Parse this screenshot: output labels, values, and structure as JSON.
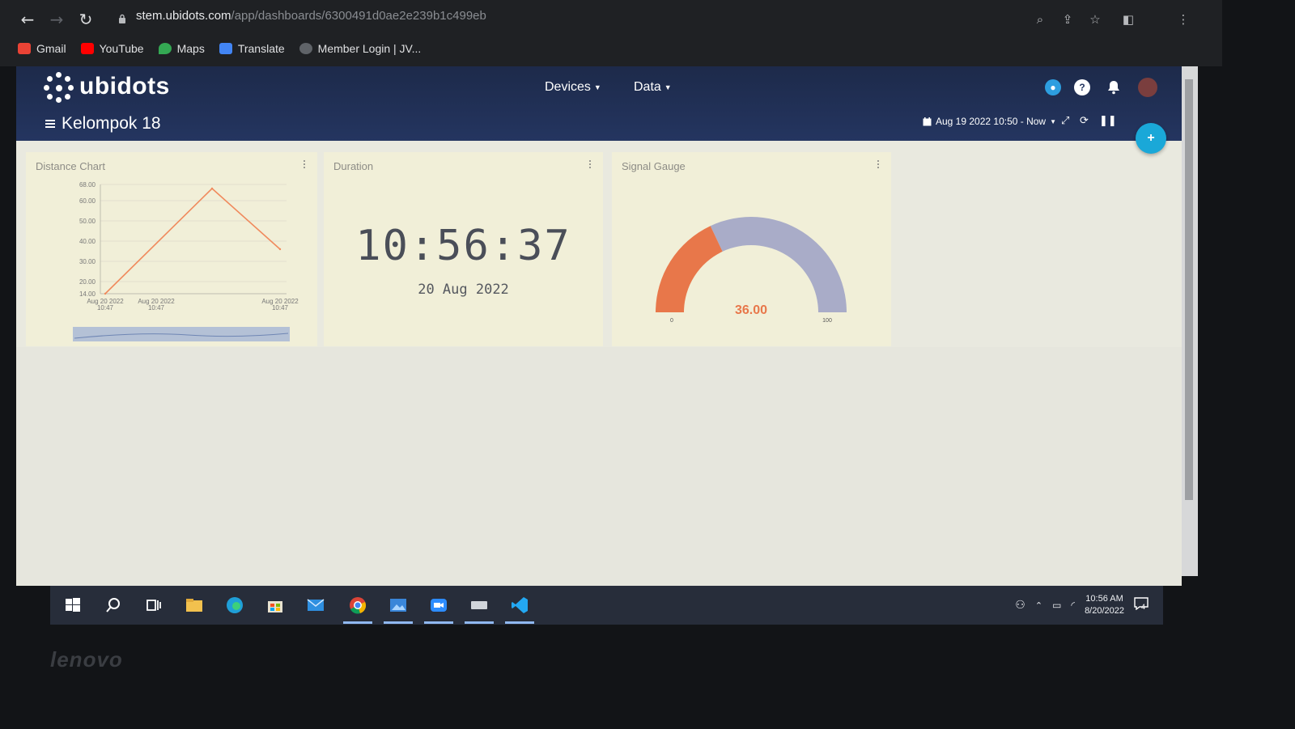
{
  "browser": {
    "url_host": "stem.ubidots.com",
    "url_path": "/app/dashboards/6300491d0ae2e239b1c499eb",
    "bookmarks": [
      {
        "label": "Gmail",
        "icon": "gmail-icon",
        "color": "#ea4335"
      },
      {
        "label": "YouTube",
        "icon": "youtube-icon",
        "color": "#ff0000"
      },
      {
        "label": "Maps",
        "icon": "maps-icon",
        "color": "#34a853"
      },
      {
        "label": "Translate",
        "icon": "translate-icon",
        "color": "#4285f4"
      },
      {
        "label": "Member Login | JV...",
        "icon": "globe-icon",
        "color": "#5f6368"
      }
    ]
  },
  "app": {
    "brand": "ubidots",
    "menu": {
      "devices": "Devices",
      "data": "Data"
    },
    "dashboard_title": "Kelompok 18",
    "date_range": "Aug 19 2022 10:50 - Now",
    "fab_label": "+",
    "accent_color": "#1aa8d8"
  },
  "widgets": {
    "distance": {
      "title": "Distance Chart"
    },
    "duration": {
      "title": "Duration",
      "time": "10:56:37",
      "date": "20 Aug 2022"
    },
    "gauge": {
      "title": "Signal Gauge",
      "value": 36,
      "value_label": "36.00",
      "min_label": "0",
      "max_label": "100",
      "color_value": "#e8774a",
      "color_rest": "#a9acc8"
    }
  },
  "chart_data": {
    "type": "line",
    "title": "",
    "xlabel": "",
    "ylabel": "",
    "y_tick_labels": [
      "68.00",
      "60.00",
      "50.00",
      "40.00",
      "30.00",
      "20.00",
      "14.00"
    ],
    "x_tick_labels": [
      [
        "Aug 20 2022",
        "10:47"
      ],
      [
        "Aug 20 2022",
        "10:47"
      ],
      [
        "Aug 20 2022",
        "10:47"
      ]
    ],
    "ylim": [
      14,
      68
    ],
    "series": [
      {
        "values": [
          14,
          66,
          36
        ],
        "color": "#f08a5d"
      }
    ]
  },
  "taskbar": {
    "clock_time": "10:56 AM",
    "clock_date": "8/20/2022",
    "notification_count": "4"
  },
  "bezel_brand": "lenovo"
}
